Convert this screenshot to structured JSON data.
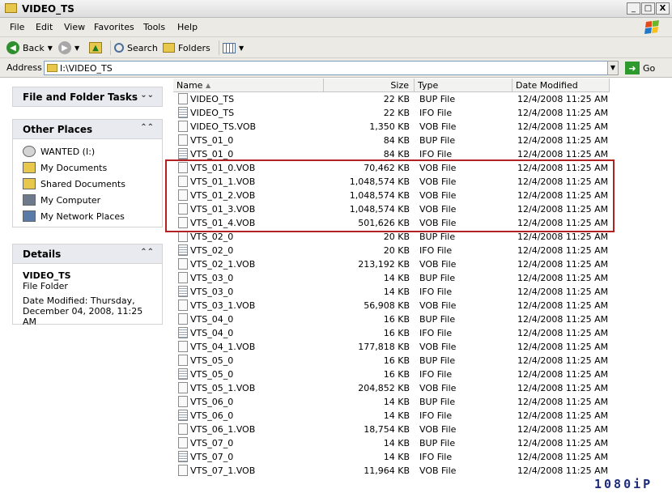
{
  "window": {
    "title": "VIDEO_TS",
    "buttons": [
      "_",
      "□",
      "X"
    ]
  },
  "menu": [
    "File",
    "Edit",
    "View",
    "Favorites",
    "Tools",
    "Help"
  ],
  "toolbar": {
    "back": "Back",
    "search": "Search",
    "folders": "Folders"
  },
  "address": {
    "label": "Address",
    "path": "I:\\VIDEO_TS",
    "go": "Go"
  },
  "tasks": {
    "file_folder_tasks": "File and Folder Tasks",
    "other_places": "Other Places",
    "places": [
      "WANTED (I:)",
      "My Documents",
      "Shared Documents",
      "My Computer",
      "My Network Places"
    ],
    "details": {
      "heading": "Details",
      "name": "VIDEO_TS",
      "kind": "File Folder",
      "modified": "Date Modified: Thursday, December 04, 2008, 11:25 AM"
    }
  },
  "columns": {
    "name": "Name",
    "size": "Size",
    "type": "Type",
    "date": "Date Modified"
  },
  "files": [
    {
      "name": "VIDEO_TS",
      "size": "22 KB",
      "type": "BUP File",
      "date": "12/4/2008 11:25 AM"
    },
    {
      "name": "VIDEO_TS",
      "size": "22 KB",
      "type": "IFO File",
      "date": "12/4/2008 11:25 AM"
    },
    {
      "name": "VIDEO_TS.VOB",
      "size": "1,350 KB",
      "type": "VOB File",
      "date": "12/4/2008 11:25 AM"
    },
    {
      "name": "VTS_01_0",
      "size": "84 KB",
      "type": "BUP File",
      "date": "12/4/2008 11:25 AM"
    },
    {
      "name": "VTS_01_0",
      "size": "84 KB",
      "type": "IFO File",
      "date": "12/4/2008 11:25 AM"
    },
    {
      "name": "VTS_01_0.VOB",
      "size": "70,462 KB",
      "type": "VOB File",
      "date": "12/4/2008 11:25 AM"
    },
    {
      "name": "VTS_01_1.VOB",
      "size": "1,048,574 KB",
      "type": "VOB File",
      "date": "12/4/2008 11:25 AM"
    },
    {
      "name": "VTS_01_2.VOB",
      "size": "1,048,574 KB",
      "type": "VOB File",
      "date": "12/4/2008 11:25 AM"
    },
    {
      "name": "VTS_01_3.VOB",
      "size": "1,048,574 KB",
      "type": "VOB File",
      "date": "12/4/2008 11:25 AM"
    },
    {
      "name": "VTS_01_4.VOB",
      "size": "501,626 KB",
      "type": "VOB File",
      "date": "12/4/2008 11:25 AM"
    },
    {
      "name": "VTS_02_0",
      "size": "20 KB",
      "type": "BUP File",
      "date": "12/4/2008 11:25 AM"
    },
    {
      "name": "VTS_02_0",
      "size": "20 KB",
      "type": "IFO File",
      "date": "12/4/2008 11:25 AM"
    },
    {
      "name": "VTS_02_1.VOB",
      "size": "213,192 KB",
      "type": "VOB File",
      "date": "12/4/2008 11:25 AM"
    },
    {
      "name": "VTS_03_0",
      "size": "14 KB",
      "type": "BUP File",
      "date": "12/4/2008 11:25 AM"
    },
    {
      "name": "VTS_03_0",
      "size": "14 KB",
      "type": "IFO File",
      "date": "12/4/2008 11:25 AM"
    },
    {
      "name": "VTS_03_1.VOB",
      "size": "56,908 KB",
      "type": "VOB File",
      "date": "12/4/2008 11:25 AM"
    },
    {
      "name": "VTS_04_0",
      "size": "16 KB",
      "type": "BUP File",
      "date": "12/4/2008 11:25 AM"
    },
    {
      "name": "VTS_04_0",
      "size": "16 KB",
      "type": "IFO File",
      "date": "12/4/2008 11:25 AM"
    },
    {
      "name": "VTS_04_1.VOB",
      "size": "177,818 KB",
      "type": "VOB File",
      "date": "12/4/2008 11:25 AM"
    },
    {
      "name": "VTS_05_0",
      "size": "16 KB",
      "type": "BUP File",
      "date": "12/4/2008 11:25 AM"
    },
    {
      "name": "VTS_05_0",
      "size": "16 KB",
      "type": "IFO File",
      "date": "12/4/2008 11:25 AM"
    },
    {
      "name": "VTS_05_1.VOB",
      "size": "204,852 KB",
      "type": "VOB File",
      "date": "12/4/2008 11:25 AM"
    },
    {
      "name": "VTS_06_0",
      "size": "14 KB",
      "type": "BUP File",
      "date": "12/4/2008 11:25 AM"
    },
    {
      "name": "VTS_06_0",
      "size": "14 KB",
      "type": "IFO File",
      "date": "12/4/2008 11:25 AM"
    },
    {
      "name": "VTS_06_1.VOB",
      "size": "18,754 KB",
      "type": "VOB File",
      "date": "12/4/2008 11:25 AM"
    },
    {
      "name": "VTS_07_0",
      "size": "14 KB",
      "type": "BUP File",
      "date": "12/4/2008 11:25 AM"
    },
    {
      "name": "VTS_07_0",
      "size": "14 KB",
      "type": "IFO File",
      "date": "12/4/2008 11:25 AM"
    },
    {
      "name": "VTS_07_1.VOB",
      "size": "11,964 KB",
      "type": "VOB File",
      "date": "12/4/2008 11:25 AM"
    }
  ],
  "watermark": "1080iP",
  "colors": {
    "highlight": "#b32222",
    "watermark": "#1d2b7a"
  }
}
